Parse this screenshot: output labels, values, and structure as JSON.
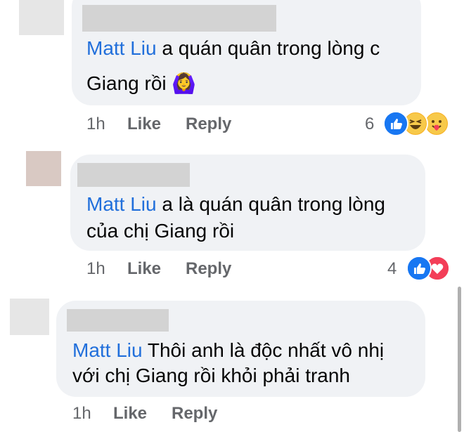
{
  "comments": [
    {
      "mention": "Matt Liu",
      "text_line1": " a quán quân trong lòng c",
      "text_line2": "Giang rồi ",
      "emoji": "🙆‍♀️",
      "time": "1h",
      "like": "Like",
      "reply": "Reply",
      "reaction_count": "6",
      "reactions": [
        "like-icon",
        "haha-icon",
        "care-icon"
      ]
    },
    {
      "mention": "Matt Liu",
      "text_line1": " a là quán quân trong lòng",
      "text_line2": "của chị Giang rồi",
      "time": "1h",
      "like": "Like",
      "reply": "Reply",
      "reaction_count": "4",
      "reactions": [
        "like-icon",
        "love-icon"
      ]
    },
    {
      "mention": "Matt Liu",
      "text_line1": " Thôi anh là độc nhất vô nhị",
      "text_line2": "với chị Giang rồi khỏi phải tranh",
      "time": "1h",
      "like": "Like",
      "reply": "Reply"
    }
  ],
  "colors": {
    "mention": "#216fdb",
    "bubble": "#f0f2f5",
    "like_blue": "#1877f2",
    "love_red": "#f33e58",
    "haha_yellow": "#f7b125"
  }
}
